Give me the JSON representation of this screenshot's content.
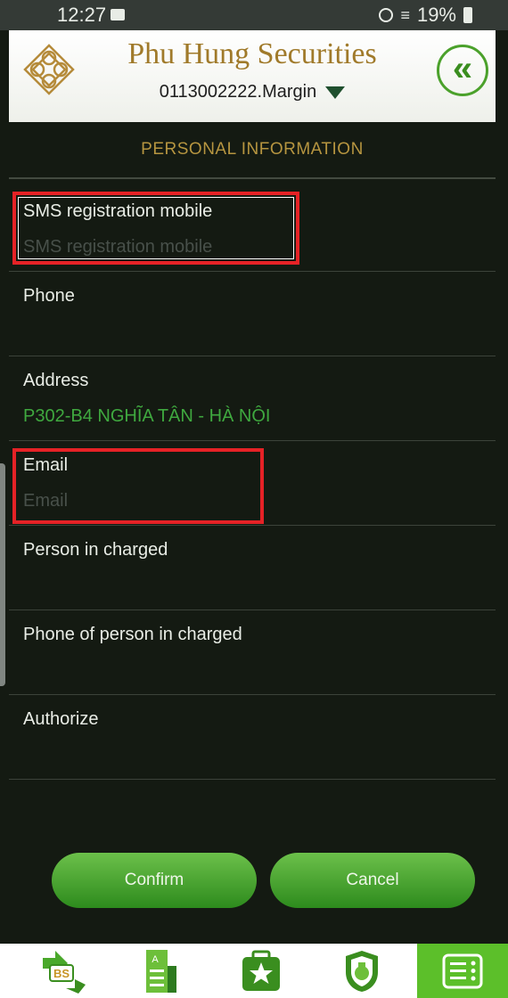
{
  "status_bar": {
    "time": "12:27",
    "battery": "19%"
  },
  "header": {
    "brand": "Phu Hung Securities",
    "account": "0113002222.Margin"
  },
  "section_title": "PERSONAL INFORMATION",
  "fields": [
    {
      "label": "SMS registration mobile",
      "value": "",
      "placeholder": "SMS registration mobile"
    },
    {
      "label": "Phone",
      "value": "",
      "placeholder": ""
    },
    {
      "label": "Address",
      "value": "P302-B4 NGHĨA TÂN - HÀ NỘI",
      "placeholder": ""
    },
    {
      "label": "Email",
      "value": "",
      "placeholder": "Email"
    },
    {
      "label": "Person in charged",
      "value": "",
      "placeholder": ""
    },
    {
      "label": "Phone of person in charged",
      "value": "",
      "placeholder": ""
    },
    {
      "label": "Authorize",
      "value": "",
      "placeholder": ""
    }
  ],
  "buttons": {
    "confirm": "Confirm",
    "cancel": "Cancel"
  },
  "bottom_nav": [
    {
      "icon": "buy-sell-icon",
      "label": "BS"
    },
    {
      "icon": "statement-icon",
      "label": "A"
    },
    {
      "icon": "watchlist-star-icon",
      "label": ""
    },
    {
      "icon": "money-bag-icon",
      "label": ""
    },
    {
      "icon": "menu-icon",
      "label": "",
      "active": true
    }
  ],
  "colors": {
    "accent_green": "#5cbf2a",
    "gold": "#a07a2a",
    "background": "#141a12",
    "highlight_red": "#e52226"
  }
}
